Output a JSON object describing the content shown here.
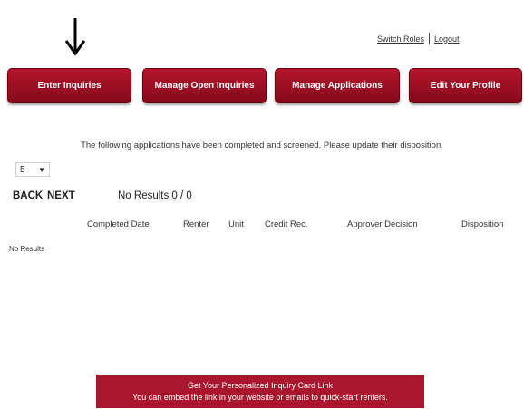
{
  "header": {
    "switch_roles": "Switch Roles",
    "logout": "Logout"
  },
  "nav": {
    "enter_inquiries": "Enter Inquiries",
    "manage_open_inquiries": "Manage Open Inquiries",
    "manage_applications": "Manage Applications",
    "edit_profile": "Edit Your Profile"
  },
  "main": {
    "intro": "The following applications have been completed and screened. Please update their disposition.",
    "page_size": "5",
    "pager": {
      "back": "BACK",
      "next": "NEXT",
      "results": "No Results 0  /  0"
    },
    "columns": [
      "Completed Date",
      "Renter",
      "Unit",
      "Credit Rec.",
      "Approver Decision",
      "Disposition"
    ],
    "no_results": "No Results"
  },
  "banner": {
    "line1": "Get Your Personalized Inquiry Card Link",
    "line2": "You can embed the link in your website or emails to quick-start renters."
  },
  "colors": {
    "accent": "#a9162d",
    "text": "#2b2b2b"
  }
}
